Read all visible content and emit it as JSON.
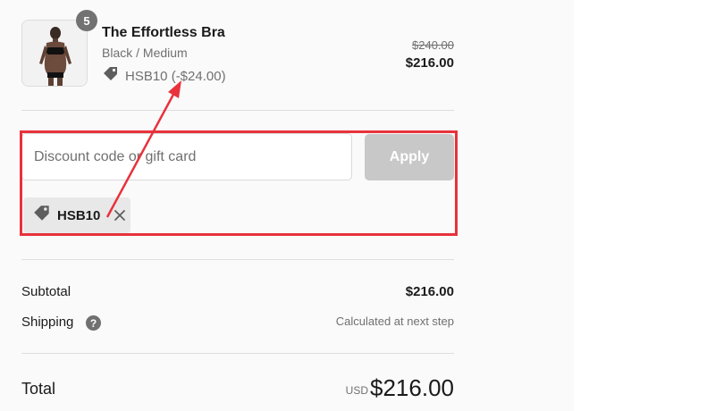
{
  "product": {
    "quantity": "5",
    "title": "The Effortless Bra",
    "variant": "Black / Medium",
    "discount_line": "HSB10 (-$24.00)",
    "original_price": "$240.00",
    "price": "$216.00"
  },
  "discount": {
    "placeholder": "Discount code or gift card",
    "value": "",
    "apply_label": "Apply",
    "applied_code": "HSB10"
  },
  "summary": {
    "subtotal_label": "Subtotal",
    "subtotal_value": "$216.00",
    "shipping_label": "Shipping",
    "shipping_help": "?",
    "shipping_value": "Calculated at next step",
    "total_label": "Total",
    "currency": "USD",
    "total_value": "$216.00"
  },
  "colors": {
    "annotation": "#e8323c",
    "apply_disabled": "#c8c8c8",
    "panel_bg": "#fafafa"
  },
  "icons": {
    "tag": "tag-icon",
    "close": "close-icon",
    "help": "help-icon"
  }
}
